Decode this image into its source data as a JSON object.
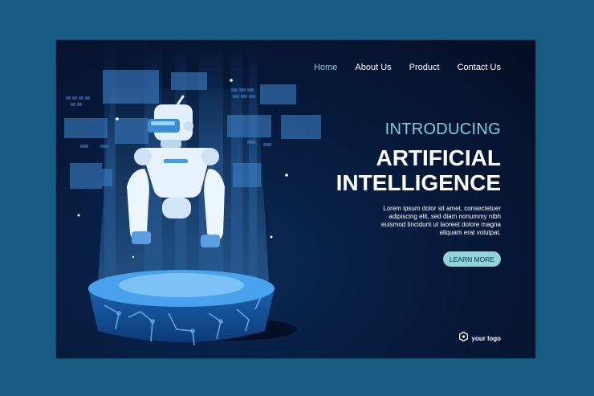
{
  "nav": {
    "items": [
      "Home",
      "About Us",
      "Product",
      "Contact Us"
    ],
    "active": "Home"
  },
  "hero": {
    "intro": "INTRODUCING",
    "title_line1": "ARTIFICIAL",
    "title_line2": "INTELLIGENCE",
    "body_line1": "Lorem ipsum dolor sit amet, consectetuer",
    "body_line2": "adipiscing elit, sed diam nonummy nibh",
    "body_line3": "euismod tincidunt ut laoreet dolore magna",
    "body_line4": "aliquam erat volutpat.",
    "cta": "LEARN MORE"
  },
  "logo": {
    "text": "your logo",
    "icon": "hexagon-logo-icon"
  },
  "colors": {
    "outer_background": "#155b82",
    "page_background": "#071b3d",
    "accent": "#7fcfe3",
    "button": "#8fd4d8"
  }
}
